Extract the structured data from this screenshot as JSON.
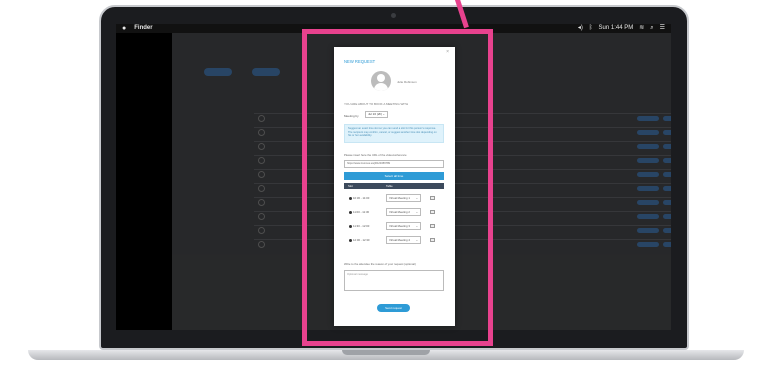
{
  "menubar": {
    "app_name": "Finder",
    "clock": "Sun 1:44 PM",
    "icons": [
      "apple-icon",
      "volume-icon",
      "bluetooth-icon",
      "wifi-icon",
      "search-icon",
      "list-icon"
    ]
  },
  "modal": {
    "close_label": "×",
    "title": "NEW REQUEST",
    "person_name": "Julie Robinson",
    "intro": "YOU ARE ABOUT TO BOOK A MEETING WITH",
    "meeting_by_label": "Meeting by",
    "meeting_by_value": "Jul 16 (2h)",
    "note": "Suggest an exact time slot so you can send a slot for this person's response. The recipient may confirm, cancel, or suggest another time slot depending on his or her availability.",
    "url_label": "Please insert here the URL of the videoconference",
    "url_value": "https://www.zoomus.us/j/0123456789",
    "select_all_label": "Select all time",
    "table_headers": {
      "slot": "Slot",
      "table": "Table"
    },
    "slots": [
      {
        "time": "10:30 - 11:00",
        "table": "Virtual Meeting 1"
      },
      {
        "time": "11:00 - 11:30",
        "table": "Virtual Meeting 2"
      },
      {
        "time": "11:30 - 12:00",
        "table": "Virtual Meeting 3"
      },
      {
        "time": "12:00 - 12:30",
        "table": "Virtual Meeting 4"
      }
    ],
    "remark_label": "Write to the attendee the reason of your request (optional)",
    "remark_placeholder": "Optional message",
    "send_label": "Send request"
  },
  "colors": {
    "highlight": "#e8428e",
    "accent": "#2e9bd6"
  }
}
